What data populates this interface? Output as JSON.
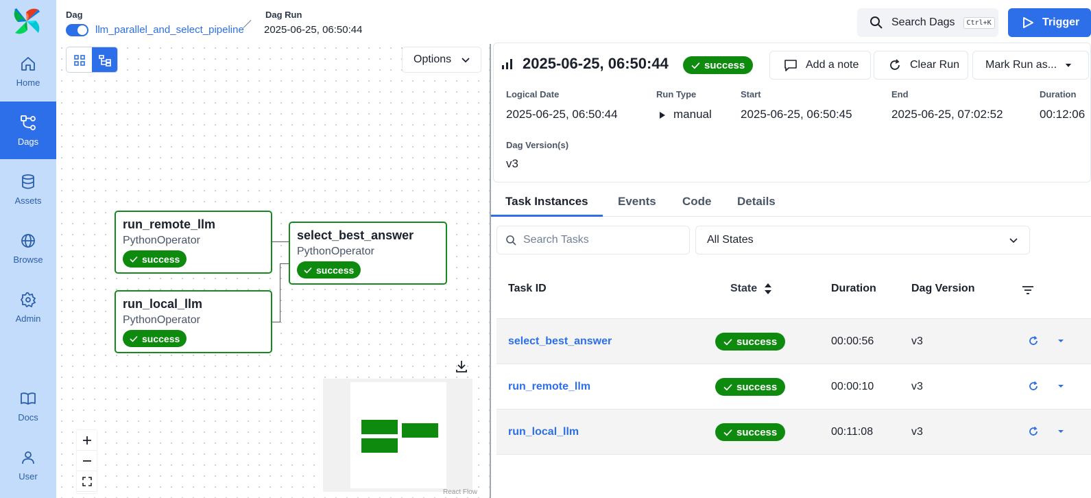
{
  "header": {
    "dag_label": "Dag",
    "dag_name": "llm_parallel_and_select_pipeline",
    "run_label": "Dag Run",
    "run_id": "2025-06-25, 06:50:44",
    "search_label": "Search Dags",
    "search_shortcut": "Ctrl+K",
    "trigger_label": "Trigger"
  },
  "sidebar": {
    "items": [
      {
        "label": "Home",
        "icon": "home-icon"
      },
      {
        "label": "Dags",
        "icon": "dags-icon",
        "active": true
      },
      {
        "label": "Assets",
        "icon": "database-icon"
      },
      {
        "label": "Browse",
        "icon": "globe-icon"
      },
      {
        "label": "Admin",
        "icon": "gear-icon"
      },
      {
        "label": "Docs",
        "icon": "book-icon"
      },
      {
        "label": "User",
        "icon": "user-icon"
      }
    ]
  },
  "graph": {
    "options_label": "Options",
    "nodes": [
      {
        "title": "run_remote_llm",
        "operator": "PythonOperator",
        "state": "success"
      },
      {
        "title": "run_local_llm",
        "operator": "PythonOperator",
        "state": "success"
      },
      {
        "title": "select_best_answer",
        "operator": "PythonOperator",
        "state": "success"
      }
    ],
    "attribution": "React Flow"
  },
  "run": {
    "title": "2025-06-25, 06:50:44",
    "state": "success",
    "actions": {
      "add_note": "Add a note",
      "clear_run": "Clear Run",
      "mark_run": "Mark Run as..."
    },
    "meta": {
      "logical_date_label": "Logical Date",
      "logical_date": "2025-06-25, 06:50:44",
      "run_type_label": "Run Type",
      "run_type": "manual",
      "start_label": "Start",
      "start": "2025-06-25, 06:50:45",
      "end_label": "End",
      "end": "2025-06-25, 07:02:52",
      "duration_label": "Duration",
      "duration": "00:12:06",
      "version_label": "Dag Version(s)",
      "version": "v3"
    }
  },
  "tabs": [
    {
      "label": "Task Instances",
      "active": true
    },
    {
      "label": "Events"
    },
    {
      "label": "Code"
    },
    {
      "label": "Details"
    }
  ],
  "filters": {
    "search_placeholder": "Search Tasks",
    "states_selected": "All States"
  },
  "table": {
    "columns": {
      "task_id": "Task ID",
      "state": "State",
      "duration": "Duration",
      "dag_version": "Dag Version"
    },
    "rows": [
      {
        "task_id": "select_best_answer",
        "state": "success",
        "duration": "00:00:56",
        "dag_version": "v3"
      },
      {
        "task_id": "run_remote_llm",
        "state": "success",
        "duration": "00:00:10",
        "dag_version": "v3"
      },
      {
        "task_id": "run_local_llm",
        "state": "success",
        "duration": "00:11:08",
        "dag_version": "v3"
      }
    ]
  },
  "colors": {
    "accent": "#2c6fe8",
    "sidebar_bg": "#c4dcfb",
    "success": "#0e8a0e"
  }
}
